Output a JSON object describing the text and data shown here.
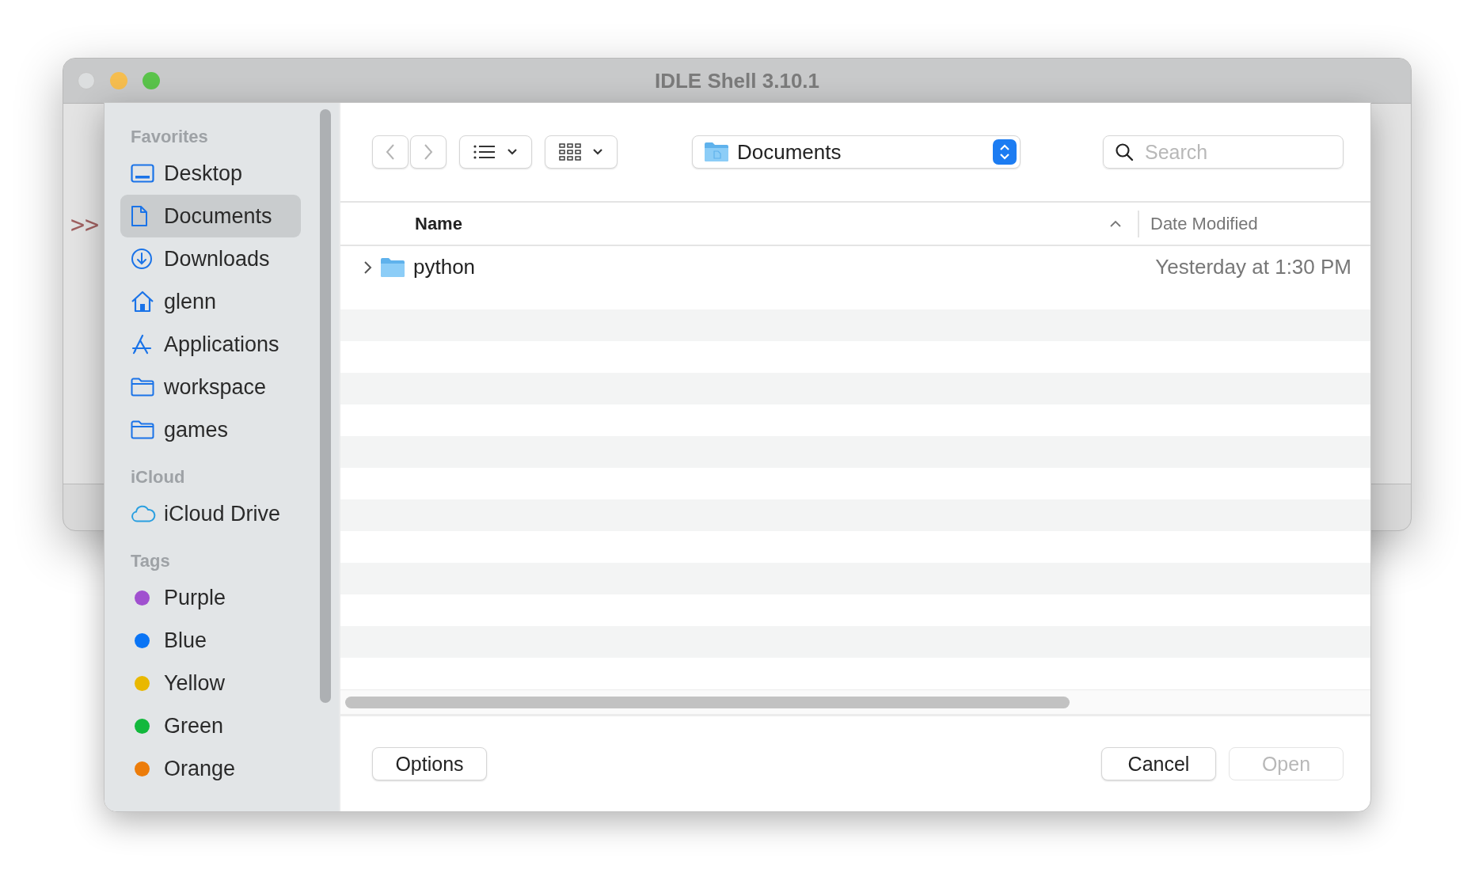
{
  "window": {
    "title": "IDLE Shell 3.10.1",
    "prompt": ">>"
  },
  "sidebar": {
    "sections": [
      {
        "title": "Favorites",
        "items": [
          {
            "label": "Desktop",
            "kind": "desktop",
            "selected": false
          },
          {
            "label": "Documents",
            "kind": "document",
            "selected": true
          },
          {
            "label": "Downloads",
            "kind": "download",
            "selected": false
          },
          {
            "label": "glenn",
            "kind": "home",
            "selected": false
          },
          {
            "label": "Applications",
            "kind": "apps",
            "selected": false
          },
          {
            "label": "workspace",
            "kind": "folder",
            "selected": false
          },
          {
            "label": "games",
            "kind": "folder",
            "selected": false
          }
        ]
      },
      {
        "title": "iCloud",
        "items": [
          {
            "label": "iCloud Drive",
            "kind": "cloud",
            "selected": false
          }
        ]
      },
      {
        "title": "Tags",
        "items": [
          {
            "label": "Purple",
            "kind": "tag",
            "color": "#a050cf",
            "selected": false
          },
          {
            "label": "Blue",
            "kind": "tag",
            "color": "#0a74f5",
            "selected": false
          },
          {
            "label": "Yellow",
            "kind": "tag",
            "color": "#e9b800",
            "selected": false
          },
          {
            "label": "Green",
            "kind": "tag",
            "color": "#12b83c",
            "selected": false
          },
          {
            "label": "Orange",
            "kind": "tag",
            "color": "#ec7c0a",
            "selected": false
          }
        ]
      }
    ]
  },
  "toolbar": {
    "location": "Documents",
    "search": {
      "placeholder": "Search"
    }
  },
  "table": {
    "columns": [
      {
        "label": "Name",
        "sorted": true
      },
      {
        "label": "Date Modified"
      }
    ],
    "rows": [
      {
        "name": "python",
        "date": "Yesterday at 1:30 PM",
        "expanded": false,
        "selected": false
      }
    ]
  },
  "footer": {
    "options": {
      "label": "Options"
    },
    "buttons": [
      {
        "label": "Cancel",
        "disabled": false
      },
      {
        "label": "Open",
        "disabled": true
      }
    ]
  }
}
